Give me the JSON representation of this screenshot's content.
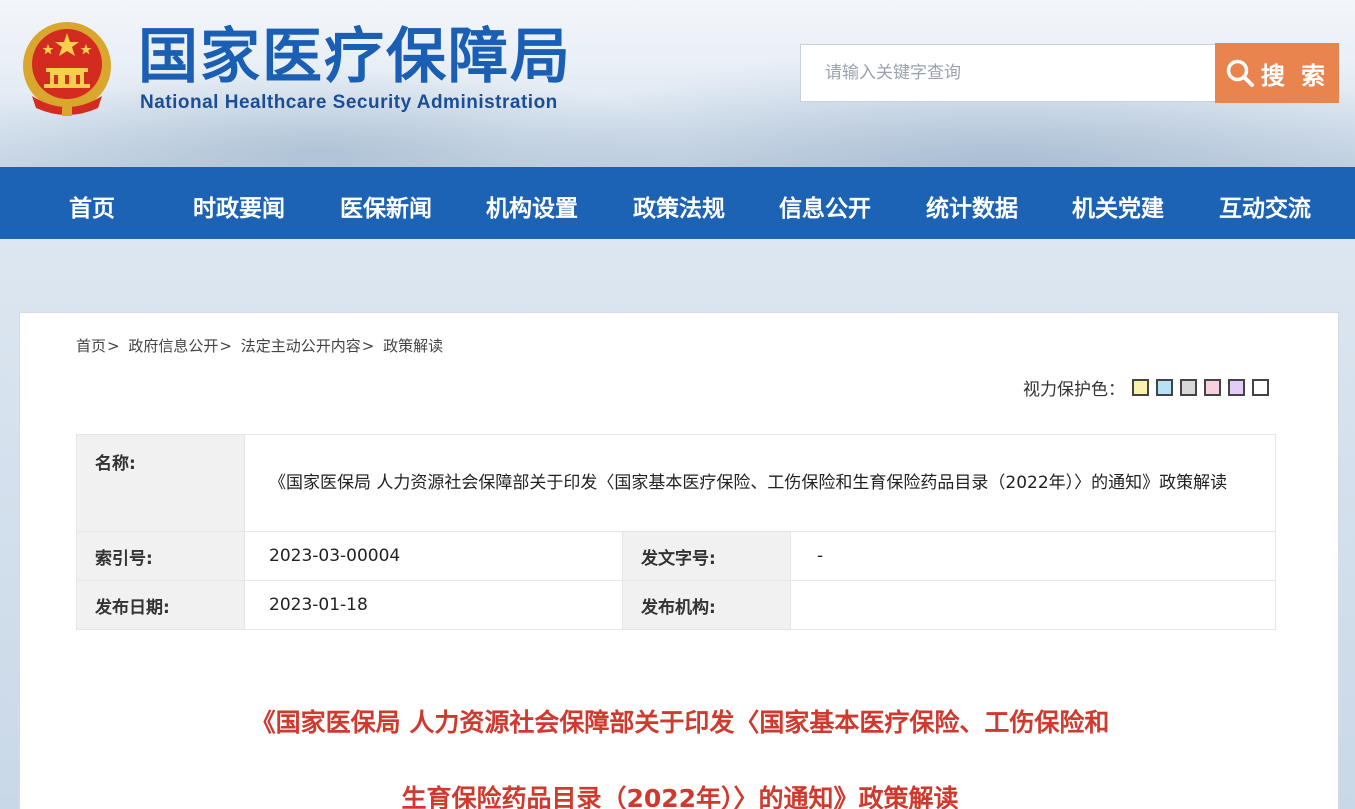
{
  "header": {
    "title_cn": "国家医疗保障局",
    "title_en": "National Healthcare Security Administration",
    "emblem_icon": "national-emblem-icon"
  },
  "search": {
    "placeholder": "请输入关键字查询",
    "button_label": "搜 索",
    "button_color": "#e9844f"
  },
  "nav": {
    "color": "#1c63b6",
    "items": [
      {
        "label": "首页"
      },
      {
        "label": "时政要闻"
      },
      {
        "label": "医保新闻"
      },
      {
        "label": "机构设置"
      },
      {
        "label": "政策法规"
      },
      {
        "label": "信息公开"
      },
      {
        "label": "统计数据"
      },
      {
        "label": "机关党建"
      },
      {
        "label": "互动交流"
      }
    ]
  },
  "breadcrumb": {
    "items": [
      "首页",
      "政府信息公开",
      "法定主动公开内容",
      "政策解读"
    ],
    "separator": ">"
  },
  "eye_protection": {
    "label": "视力保护色：",
    "colors": [
      "#f8f1b0",
      "#b6e2f7",
      "#d8d8d8",
      "#f6d0dc",
      "#e3cdf5",
      "#ffffff"
    ]
  },
  "info": {
    "name_label": "名称:",
    "name_value": "《国家医保局 人力资源社会保障部关于印发〈国家基本医疗保险、工伤保险和生育保险药品目录（2022年）〉的通知》政策解读",
    "index_label": "索引号:",
    "index_value": "2023-03-00004",
    "docno_label": "发文字号:",
    "docno_value": "-",
    "date_label": "发布日期:",
    "date_value": "2023-01-18",
    "org_label": "发布机构:",
    "org_value": ""
  },
  "article": {
    "title_line1": "《国家医保局 人力资源社会保障部关于印发〈国家基本医疗保险、工伤保险和",
    "title_line2": "生育保险药品目录（2022年）〉的通知》政策解读",
    "title_color": "#d03a2e"
  }
}
